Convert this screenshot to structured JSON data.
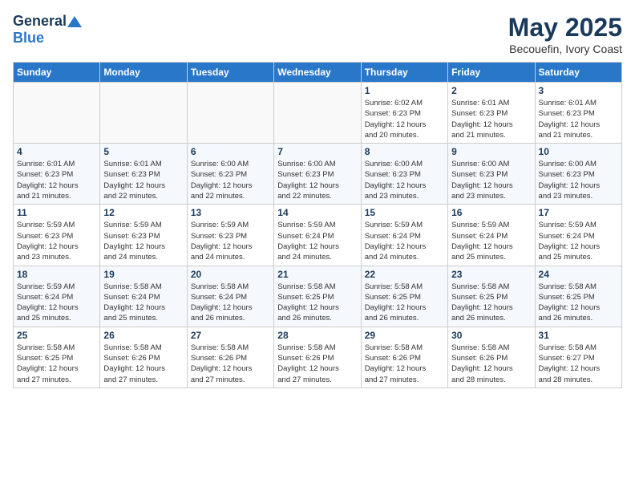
{
  "header": {
    "logo_general": "General",
    "logo_blue": "Blue",
    "title": "May 2025",
    "subtitle": "Becouefin, Ivory Coast"
  },
  "weekdays": [
    "Sunday",
    "Monday",
    "Tuesday",
    "Wednesday",
    "Thursday",
    "Friday",
    "Saturday"
  ],
  "weeks": [
    [
      {
        "num": "",
        "info": ""
      },
      {
        "num": "",
        "info": ""
      },
      {
        "num": "",
        "info": ""
      },
      {
        "num": "",
        "info": ""
      },
      {
        "num": "1",
        "info": "Sunrise: 6:02 AM\nSunset: 6:23 PM\nDaylight: 12 hours\nand 20 minutes."
      },
      {
        "num": "2",
        "info": "Sunrise: 6:01 AM\nSunset: 6:23 PM\nDaylight: 12 hours\nand 21 minutes."
      },
      {
        "num": "3",
        "info": "Sunrise: 6:01 AM\nSunset: 6:23 PM\nDaylight: 12 hours\nand 21 minutes."
      }
    ],
    [
      {
        "num": "4",
        "info": "Sunrise: 6:01 AM\nSunset: 6:23 PM\nDaylight: 12 hours\nand 21 minutes."
      },
      {
        "num": "5",
        "info": "Sunrise: 6:01 AM\nSunset: 6:23 PM\nDaylight: 12 hours\nand 22 minutes."
      },
      {
        "num": "6",
        "info": "Sunrise: 6:00 AM\nSunset: 6:23 PM\nDaylight: 12 hours\nand 22 minutes."
      },
      {
        "num": "7",
        "info": "Sunrise: 6:00 AM\nSunset: 6:23 PM\nDaylight: 12 hours\nand 22 minutes."
      },
      {
        "num": "8",
        "info": "Sunrise: 6:00 AM\nSunset: 6:23 PM\nDaylight: 12 hours\nand 23 minutes."
      },
      {
        "num": "9",
        "info": "Sunrise: 6:00 AM\nSunset: 6:23 PM\nDaylight: 12 hours\nand 23 minutes."
      },
      {
        "num": "10",
        "info": "Sunrise: 6:00 AM\nSunset: 6:23 PM\nDaylight: 12 hours\nand 23 minutes."
      }
    ],
    [
      {
        "num": "11",
        "info": "Sunrise: 5:59 AM\nSunset: 6:23 PM\nDaylight: 12 hours\nand 23 minutes."
      },
      {
        "num": "12",
        "info": "Sunrise: 5:59 AM\nSunset: 6:23 PM\nDaylight: 12 hours\nand 24 minutes."
      },
      {
        "num": "13",
        "info": "Sunrise: 5:59 AM\nSunset: 6:23 PM\nDaylight: 12 hours\nand 24 minutes."
      },
      {
        "num": "14",
        "info": "Sunrise: 5:59 AM\nSunset: 6:24 PM\nDaylight: 12 hours\nand 24 minutes."
      },
      {
        "num": "15",
        "info": "Sunrise: 5:59 AM\nSunset: 6:24 PM\nDaylight: 12 hours\nand 24 minutes."
      },
      {
        "num": "16",
        "info": "Sunrise: 5:59 AM\nSunset: 6:24 PM\nDaylight: 12 hours\nand 25 minutes."
      },
      {
        "num": "17",
        "info": "Sunrise: 5:59 AM\nSunset: 6:24 PM\nDaylight: 12 hours\nand 25 minutes."
      }
    ],
    [
      {
        "num": "18",
        "info": "Sunrise: 5:59 AM\nSunset: 6:24 PM\nDaylight: 12 hours\nand 25 minutes."
      },
      {
        "num": "19",
        "info": "Sunrise: 5:58 AM\nSunset: 6:24 PM\nDaylight: 12 hours\nand 25 minutes."
      },
      {
        "num": "20",
        "info": "Sunrise: 5:58 AM\nSunset: 6:24 PM\nDaylight: 12 hours\nand 26 minutes."
      },
      {
        "num": "21",
        "info": "Sunrise: 5:58 AM\nSunset: 6:25 PM\nDaylight: 12 hours\nand 26 minutes."
      },
      {
        "num": "22",
        "info": "Sunrise: 5:58 AM\nSunset: 6:25 PM\nDaylight: 12 hours\nand 26 minutes."
      },
      {
        "num": "23",
        "info": "Sunrise: 5:58 AM\nSunset: 6:25 PM\nDaylight: 12 hours\nand 26 minutes."
      },
      {
        "num": "24",
        "info": "Sunrise: 5:58 AM\nSunset: 6:25 PM\nDaylight: 12 hours\nand 26 minutes."
      }
    ],
    [
      {
        "num": "25",
        "info": "Sunrise: 5:58 AM\nSunset: 6:25 PM\nDaylight: 12 hours\nand 27 minutes."
      },
      {
        "num": "26",
        "info": "Sunrise: 5:58 AM\nSunset: 6:26 PM\nDaylight: 12 hours\nand 27 minutes."
      },
      {
        "num": "27",
        "info": "Sunrise: 5:58 AM\nSunset: 6:26 PM\nDaylight: 12 hours\nand 27 minutes."
      },
      {
        "num": "28",
        "info": "Sunrise: 5:58 AM\nSunset: 6:26 PM\nDaylight: 12 hours\nand 27 minutes."
      },
      {
        "num": "29",
        "info": "Sunrise: 5:58 AM\nSunset: 6:26 PM\nDaylight: 12 hours\nand 27 minutes."
      },
      {
        "num": "30",
        "info": "Sunrise: 5:58 AM\nSunset: 6:26 PM\nDaylight: 12 hours\nand 28 minutes."
      },
      {
        "num": "31",
        "info": "Sunrise: 5:58 AM\nSunset: 6:27 PM\nDaylight: 12 hours\nand 28 minutes."
      }
    ]
  ]
}
